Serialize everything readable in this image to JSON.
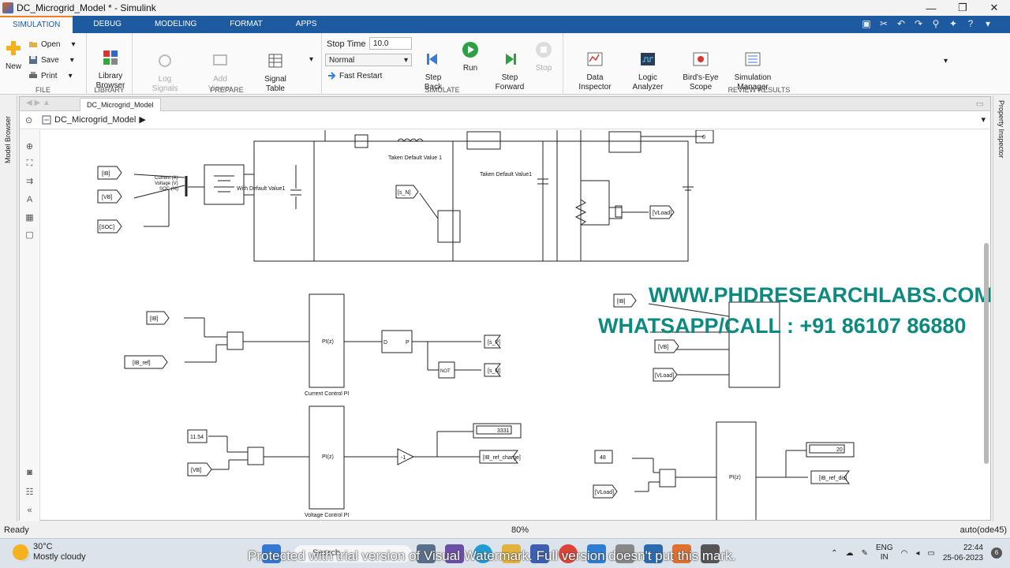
{
  "window": {
    "title": "DC_Microgrid_Model * - Simulink",
    "controls": [
      "—",
      "❐",
      "✕"
    ]
  },
  "ribbon_tabs": [
    "SIMULATION",
    "DEBUG",
    "MODELING",
    "FORMAT",
    "APPS"
  ],
  "file_group": {
    "label": "FILE",
    "new": "New",
    "open": "Open",
    "save": "Save",
    "print": "Print"
  },
  "library_group": {
    "label": "LIBRARY",
    "browser": "Library\nBrowser"
  },
  "prepare_group": {
    "label": "PREPARE",
    "log_signals": "Log\nSignals",
    "add_viewer": "Add\nViewer",
    "signal_table": "Signal\nTable"
  },
  "simulate_group": {
    "label": "SIMULATE",
    "stop_time_label": "Stop Time",
    "stop_time_value": "10.0",
    "mode": "Normal",
    "fast_restart": "Fast Restart",
    "step_back": "Step\nBack",
    "run": "Run",
    "step_forward": "Step\nForward",
    "stop": "Stop"
  },
  "review_group": {
    "label": "REVIEW RESULTS",
    "data_inspector": "Data\nInspector",
    "logic_analyzer": "Logic\nAnalyzer",
    "birds_eye": "Bird's-Eye\nScope",
    "sim_manager": "Simulation\nManager"
  },
  "side_panels": {
    "left": "Model Browser",
    "right": "Property Inspector"
  },
  "editor": {
    "tab": "DC_Microgrid_Model",
    "breadcrumb": "DC_Microgrid_Model"
  },
  "diagram": {
    "tags": {
      "ib": "[IB]",
      "vb": "[VB]",
      "soc": "[SOC]",
      "s_n": "[s_N]",
      "s_p": "[s_P]",
      "vload": "[VLoad]",
      "ib_ref": "[IB_ref]",
      "ib_ref_charge": "[IB_ref_charge]",
      "ib_ref_dis": "[IB_ref_dis]"
    },
    "battery_ports": [
      "Current (A)",
      "Voltage (V)",
      "SOC (%)"
    ],
    "labels": {
      "with_default": "With Default Value1",
      "taken1": "Taken Default Value 1",
      "taken2": "Taken Default Value1",
      "current_pi": "Current Control PI",
      "voltage_pi": "Voltage Control PI",
      "pi": "PI(z)",
      "not": "NOT",
      "gain": "-1",
      "const_zero": "0",
      "const_1154": "11.54",
      "const_48": "48",
      "display1": "3331",
      "display2": "20",
      "d": "D",
      "p": "P"
    }
  },
  "watermark_site": "WWW.PHDRESEARCHLABS.COM",
  "watermark_phone": "WHATSAPP/CALL : +91 86107 86880",
  "status": {
    "left": "Ready",
    "zoom": "80%",
    "solver": "auto(ode45)"
  },
  "taskbar": {
    "temp": "30°C",
    "weather": "Mostly cloudy",
    "search": "Search",
    "lang1": "ENG",
    "lang2": "IN",
    "time": "22:44",
    "date": "25-06-2023"
  },
  "video_watermark": "Protected with trial version of Visual Watermark. Full version doesn't put this mark."
}
